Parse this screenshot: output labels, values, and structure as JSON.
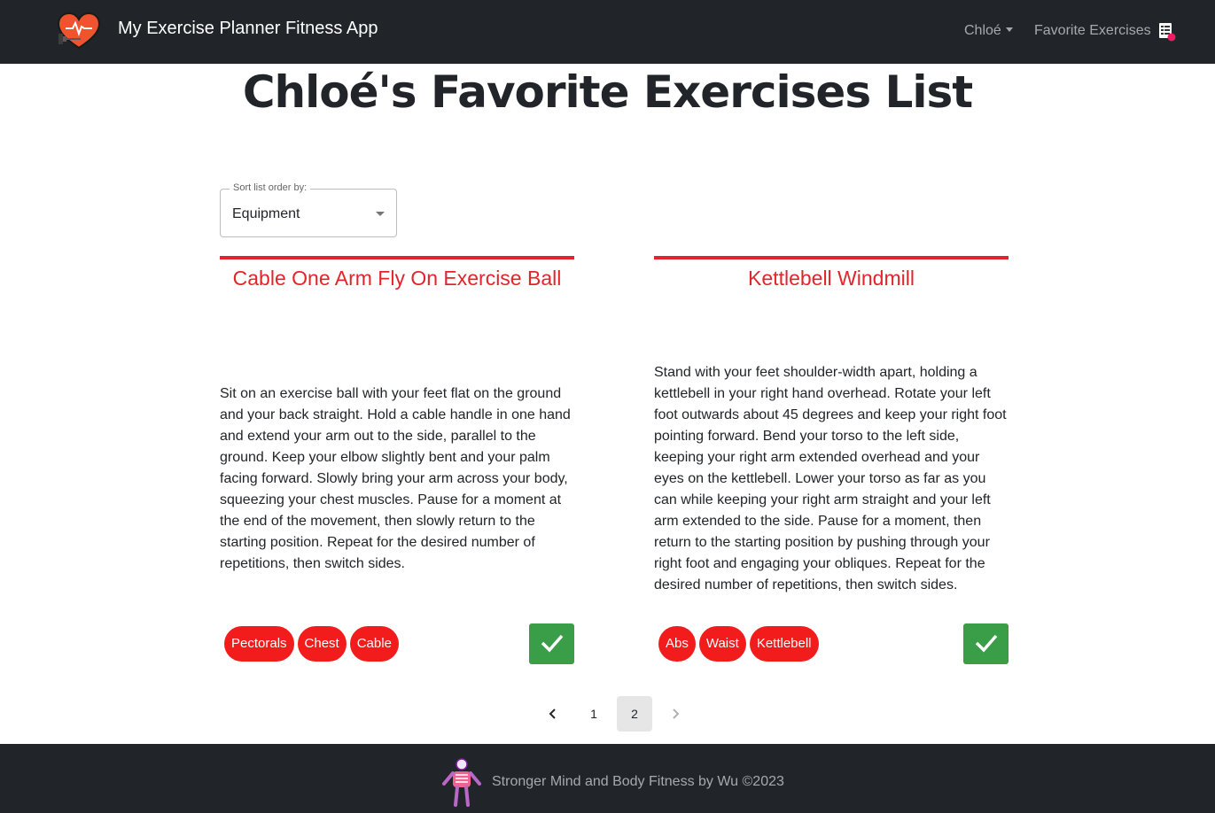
{
  "navbar": {
    "logo_icon": "heart-dumbbell-icon",
    "title": "My Exercise Planner Fitness App",
    "user_menu_label": "Chloé",
    "favorites_label": "Favorite Exercises",
    "favorites_icon": "list-heart-icon"
  },
  "page": {
    "title": "Chloé's Favorite Exercises List"
  },
  "sort": {
    "legend": "Sort list order by:",
    "selected": "Equipment"
  },
  "cards": [
    {
      "title": "Cable One Arm Fly On Exercise Ball",
      "description": "Sit on an exercise ball with your feet flat on the ground and your back straight. Hold a cable handle in one hand and extend your arm out to the side, parallel to the ground. Keep your elbow slightly bent and your palm facing forward. Slowly bring your arm across your body, squeezing your chest muscles. Pause for a moment at the end of the movement, then slowly return to the starting position. Repeat for the desired number of repetitions, then switch sides.",
      "tags": [
        "Pectorals",
        "Chest",
        "Cable"
      ]
    },
    {
      "title": "Kettlebell Windmill",
      "description": "Stand with your feet shoulder-width apart, holding a kettlebell in your right hand overhead. Rotate your left foot outwards about 45 degrees and keep your right foot pointing forward. Bend your torso to the left side, keeping your right arm extended overhead and your eyes on the kettlebell. Lower your torso as far as you can while keeping your right arm straight and your left arm extended to the side. Pause for a moment, then return to the starting position by pushing through your right foot and engaging your obliques. Repeat for the desired number of repetitions, then switch sides.",
      "tags": [
        "Abs",
        "Waist",
        "Kettlebell"
      ]
    }
  ],
  "pagination": {
    "pages": [
      "1",
      "2"
    ],
    "current": "2"
  },
  "footer": {
    "logo_icon": "skeleton-icon",
    "text": "Stronger Mind and Body Fitness by Wu ©2023"
  },
  "colors": {
    "navbar_bg": "#212529",
    "accent_red": "#e3242b",
    "tag_red": "#f31c1c",
    "check_green": "#3a9d47"
  }
}
